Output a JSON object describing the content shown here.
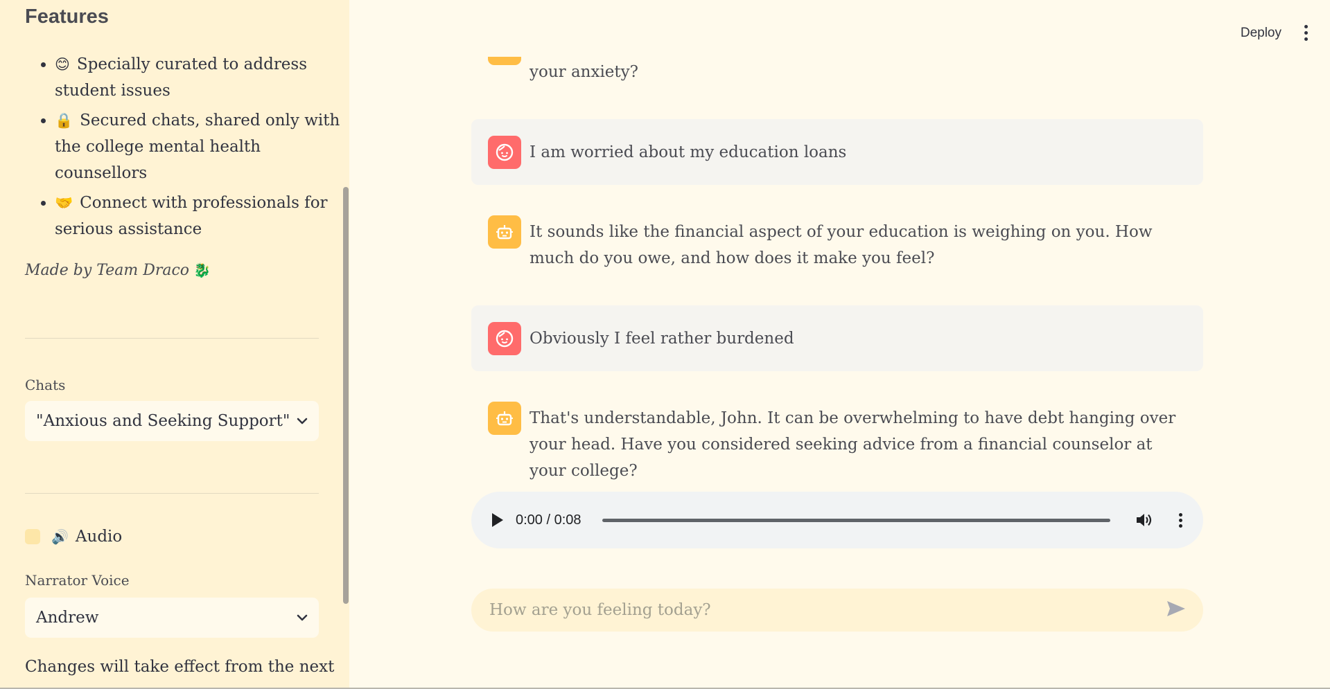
{
  "sidebar": {
    "features_title": "Features",
    "features": [
      {
        "emoji": "😊",
        "text": "Specially curated to address student issues"
      },
      {
        "emoji": "🔒",
        "text": "Secured chats, shared only with the college mental health counsellors"
      },
      {
        "emoji": "🤝",
        "text": "Connect with professionals for serious assistance"
      }
    ],
    "made_by": "Made by Team Draco",
    "made_by_emoji": "🐉",
    "chats_label": "Chats",
    "chats_selected": "\"Anxious and Seeking Support\"",
    "audio_label": "Audio",
    "audio_icon": "🔊",
    "narrator_label": "Narrator Voice",
    "narrator_selected": "Andrew",
    "changes_note": "Changes will take effect from the next"
  },
  "header": {
    "deploy_label": "Deploy"
  },
  "messages": [
    {
      "role": "bot",
      "text": "your anxiety?"
    },
    {
      "role": "user",
      "text": "I am worried about my education loans"
    },
    {
      "role": "bot",
      "text": "It sounds like the financial aspect of your education is weighing on you. How much do you owe, and how does it make you feel?"
    },
    {
      "role": "user",
      "text": "Obviously I feel rather burdened"
    },
    {
      "role": "bot",
      "text": "That's understandable, John. It can be overwhelming to have debt hanging over your head. Have you considered seeking advice from a financial counselor at your college?"
    }
  ],
  "audio_player": {
    "time": "0:00 / 0:08"
  },
  "chat_input": {
    "placeholder": "How are you feeling today?"
  },
  "colors": {
    "user_avatar": "#ff6b6b",
    "bot_avatar": "#ffbd45",
    "sidebar_bg": "#fff3d4",
    "main_bg": "#fffaec"
  }
}
